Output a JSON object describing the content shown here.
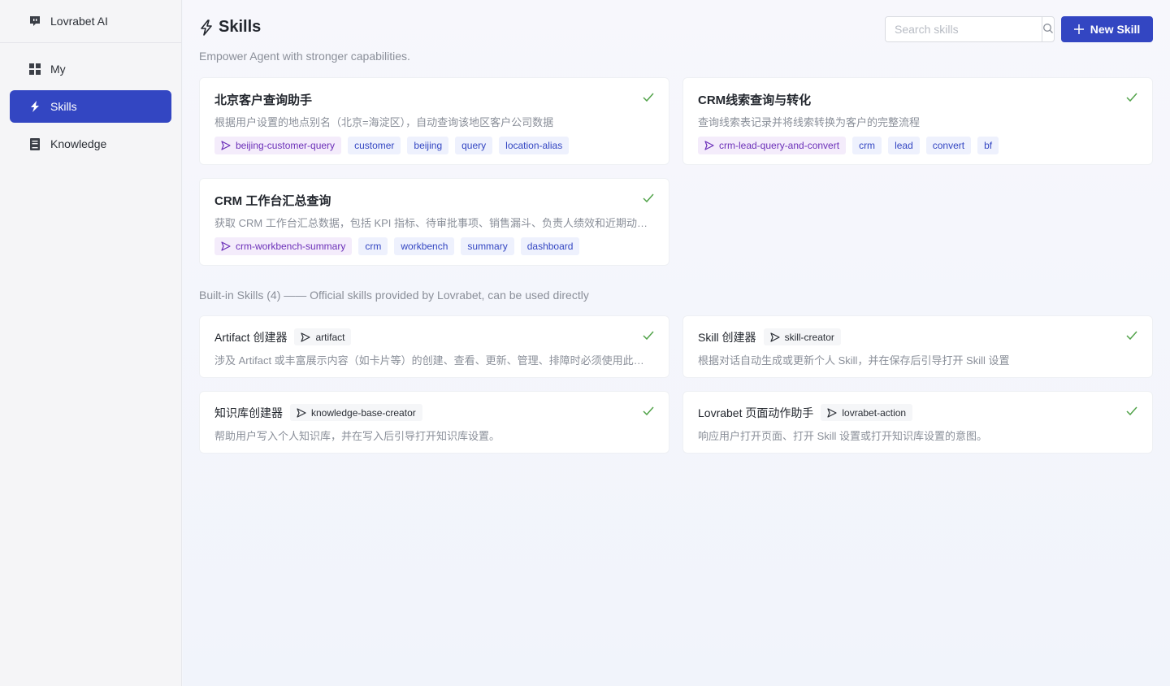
{
  "sidebar": {
    "brand": "Lovrabet AI",
    "items": [
      {
        "label": "My",
        "icon": "grid-icon"
      },
      {
        "label": "Skills",
        "icon": "bolt-icon"
      },
      {
        "label": "Knowledge",
        "icon": "book-icon"
      }
    ]
  },
  "header": {
    "title": "Skills",
    "subtitle": "Empower Agent with stronger capabilities.",
    "search_placeholder": "Search skills",
    "new_button": "New Skill"
  },
  "my_skills": [
    {
      "name": "北京客户查询助手",
      "desc": "根据用户设置的地点别名（北京=海淀区），自动查询该地区客户公司数据",
      "id": "beijing-customer-query",
      "tags": [
        "customer",
        "beijing",
        "query",
        "location-alias"
      ]
    },
    {
      "name": "CRM线索查询与转化",
      "desc": "查询线索表记录并将线索转换为客户的完整流程",
      "id": "crm-lead-query-and-convert",
      "tags": [
        "crm",
        "lead",
        "convert",
        "bf"
      ]
    },
    {
      "name": "CRM 工作台汇总查询",
      "desc": "获取 CRM 工作台汇总数据，包括 KPI 指标、待审批事项、销售漏斗、负责人绩效和近期动态等",
      "id": "crm-workbench-summary",
      "tags": [
        "crm",
        "workbench",
        "summary",
        "dashboard"
      ]
    }
  ],
  "builtin": {
    "label": "Built-in Skills (4) —— Official skills provided by Lovrabet, can be used directly",
    "items": [
      {
        "name": "Artifact 创建器",
        "id": "artifact",
        "desc": "涉及 Artifact 或丰富展示内容（如卡片等）的创建、查看、更新、管理、排障时必须使用此技能"
      },
      {
        "name": "Skill 创建器",
        "id": "skill-creator",
        "desc": "根据对话自动生成或更新个人 Skill，并在保存后引导打开 Skill 设置"
      },
      {
        "name": "知识库创建器",
        "id": "knowledge-base-creator",
        "desc": "帮助用户写入个人知识库，并在写入后引导打开知识库设置。"
      },
      {
        "name": "Lovrabet 页面动作助手",
        "id": "lovrabet-action",
        "desc": "响应用户打开页面、打开 Skill 设置或打开知识库设置的意图。"
      }
    ]
  },
  "colors": {
    "accent": "#3346c2",
    "check": "#52a34a",
    "tag_primary_text": "#6b2fb8"
  }
}
